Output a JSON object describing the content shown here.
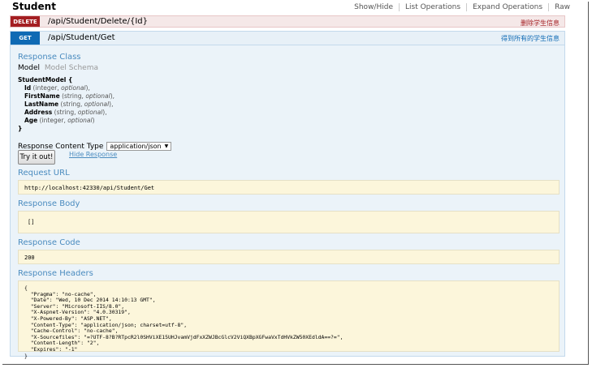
{
  "header": {
    "title": "Student",
    "links": [
      "Show/Hide",
      "List Operations",
      "Expand Operations",
      "Raw"
    ]
  },
  "delete_op": {
    "method": "DELETE",
    "path": "/api/Student/Delete/{Id}",
    "description": "删除学生信息"
  },
  "get_op": {
    "method": "GET",
    "path": "/api/Student/Get",
    "description": "得到所有的学生信息",
    "response_class_title": "Response Class",
    "tab_model": "Model",
    "tab_schema": "Model Schema",
    "model": {
      "name": "StudentModel {",
      "close": "}",
      "fields": [
        {
          "name": "Id",
          "meta_open": " (",
          "type": "integer",
          "sep": ", ",
          "opt": "optional",
          "meta_close": "),"
        },
        {
          "name": "FirstName",
          "meta_open": " (",
          "type": "string",
          "sep": ", ",
          "opt": "optional",
          "meta_close": "),"
        },
        {
          "name": "LastName",
          "meta_open": " (",
          "type": "string",
          "sep": ", ",
          "opt": "optional",
          "meta_close": "),"
        },
        {
          "name": "Address",
          "meta_open": " (",
          "type": "string",
          "sep": ", ",
          "opt": "optional",
          "meta_close": "),"
        },
        {
          "name": "Age",
          "meta_open": " (",
          "type": "integer",
          "sep": ", ",
          "opt": "optional",
          "meta_close": ")"
        }
      ]
    },
    "content_type_label": "Response Content Type",
    "content_type_value": "application/json",
    "try_button": "Try it out!",
    "hide_response": "Hide Response",
    "request_url_title": "Request URL",
    "request_url": "http://localhost:42330/api/Student/Get",
    "response_body_title": "Response Body",
    "response_body": "[]",
    "response_code_title": "Response Code",
    "response_code": "200",
    "response_headers_title": "Response Headers",
    "response_headers": "{\n  \"Pragma\": \"no-cache\",\n  \"Date\": \"Wed, 10 Dec 2014 14:10:13 GMT\",\n  \"Server\": \"Microsoft-IIS/8.0\",\n  \"X-Aspnet-Version\": \"4.0.30319\",\n  \"X-Powered-By\": \"ASP.NET\",\n  \"Content-Type\": \"application/json; charset=utf-8\",\n  \"Cache-Control\": \"no-cache\",\n  \"X-Sourcefiles\": \"=?UTF-8?B?RTpcR2l0SHViXE15UHJvamVjdFxXZWJBcGlcV2ViQXBpXGFwaVxTdHVkZW50XEdldA==?=\",\n  \"Content-Length\": \"2\",\n  \"Expires\": \"-1\"\n}"
  },
  "colors": {
    "delete": "#a41e22",
    "get": "#0f6ab4",
    "section_title": "#4a8bbf",
    "response_box": "#fcf6db"
  }
}
